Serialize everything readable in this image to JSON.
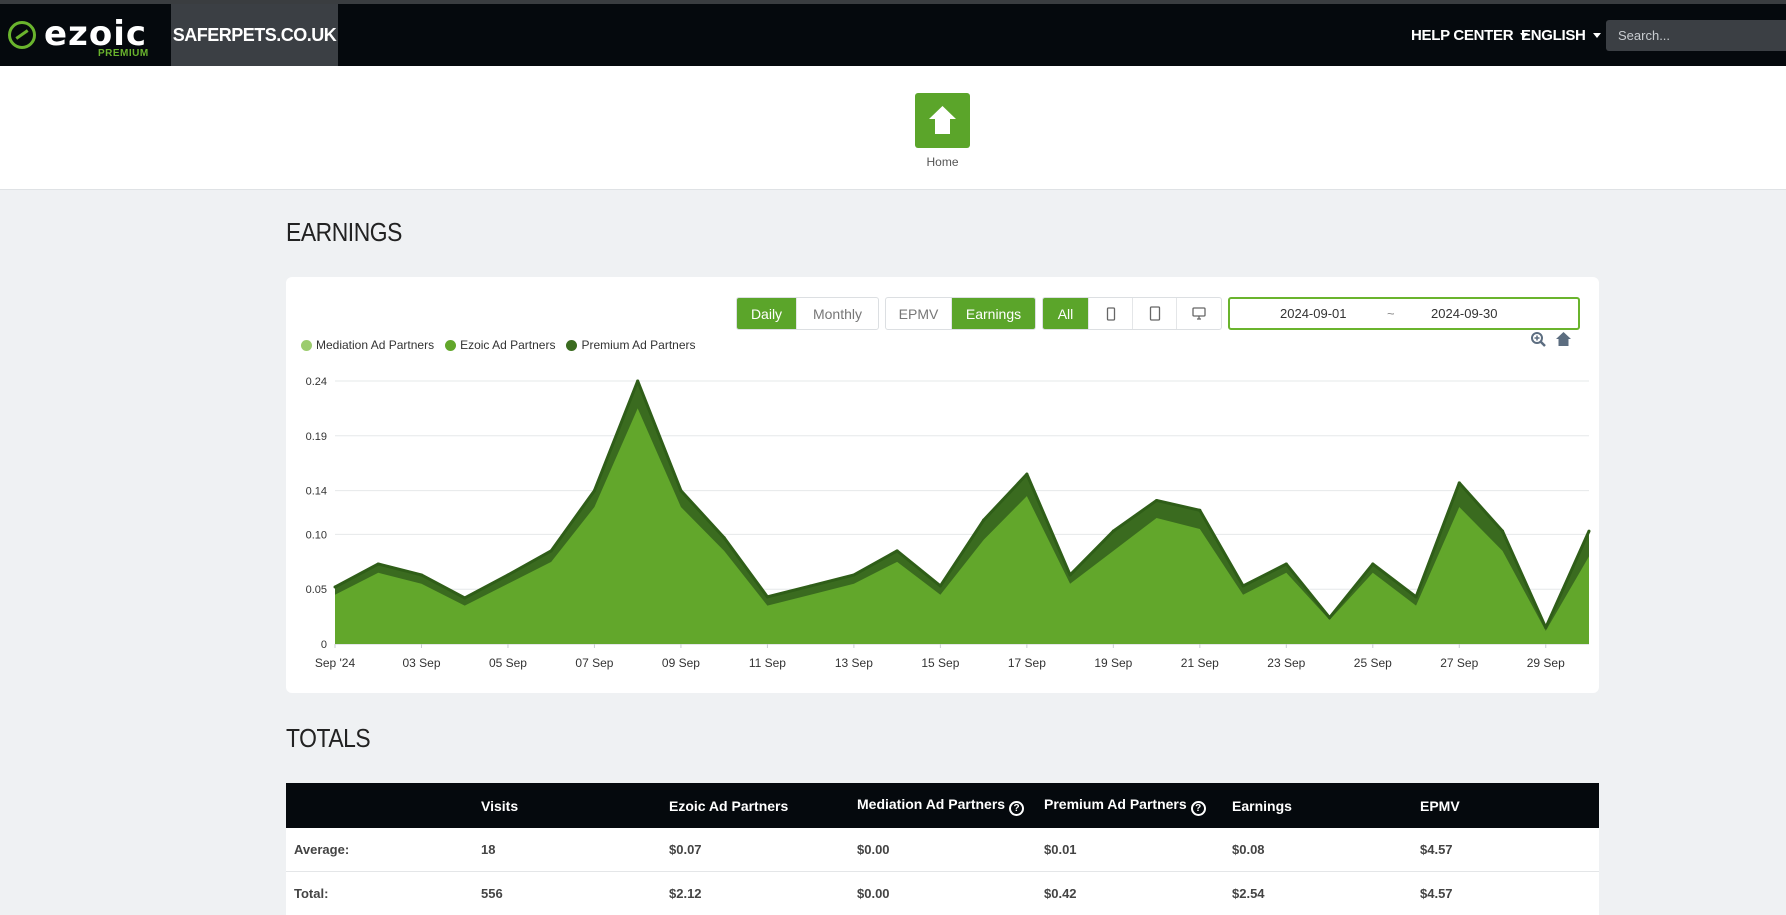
{
  "nav": {
    "logo_text": "ezoic",
    "logo_sub": "PREMIUM",
    "site": "SAFERPETS.CO.UK",
    "help_center": "HELP CENTER",
    "language": "ENGLISH",
    "search_placeholder": "Search..."
  },
  "home": {
    "label": "Home"
  },
  "earnings": {
    "title": "EARNINGS",
    "period_buttons": [
      {
        "label": "Daily",
        "active": true
      },
      {
        "label": "Monthly",
        "active": false
      }
    ],
    "metric_buttons": [
      {
        "label": "EPMV",
        "active": false
      },
      {
        "label": "Earnings",
        "active": true
      }
    ],
    "device_buttons": [
      {
        "label": "All",
        "icon": "",
        "active": true
      },
      {
        "label": "",
        "icon": "mobile-icon",
        "active": false
      },
      {
        "label": "",
        "icon": "tablet-icon",
        "active": false
      },
      {
        "label": "",
        "icon": "desktop-icon",
        "active": false
      }
    ],
    "date_start": "2024-09-01",
    "date_sep": "~",
    "date_end": "2024-09-30",
    "tools": [
      "zoom-icon",
      "reset-home-icon"
    ]
  },
  "chart_data": {
    "type": "area",
    "stacked": true,
    "x_tick_labels": [
      "Sep '24",
      "03 Sep",
      "05 Sep",
      "07 Sep",
      "09 Sep",
      "11 Sep",
      "13 Sep",
      "15 Sep",
      "17 Sep",
      "19 Sep",
      "21 Sep",
      "23 Sep",
      "25 Sep",
      "27 Sep",
      "29 Sep"
    ],
    "y_tick_labels": [
      "0",
      "0.05",
      "0.10",
      "0.14",
      "0.19",
      "0.24"
    ],
    "ylim": [
      0,
      0.24
    ],
    "grid": true,
    "legend_position": "top-left",
    "days": [
      1,
      2,
      3,
      4,
      5,
      6,
      7,
      8,
      9,
      10,
      11,
      12,
      13,
      14,
      15,
      16,
      17,
      18,
      19,
      20,
      21,
      22,
      23,
      24,
      25,
      26,
      27,
      28,
      29,
      30
    ],
    "series": [
      {
        "name": "Mediation Ad Partners",
        "color": "#9ccc6e",
        "values": [
          0,
          0,
          0,
          0,
          0,
          0,
          0,
          0,
          0,
          0,
          0,
          0,
          0,
          0,
          0,
          0,
          0,
          0,
          0,
          0,
          0,
          0,
          0,
          0,
          0,
          0,
          0,
          0,
          0,
          0
        ]
      },
      {
        "name": "Ezoic Ad Partners",
        "color": "#62a72b",
        "values": [
          0.045,
          0.065,
          0.055,
          0.035,
          0.055,
          0.075,
          0.125,
          0.215,
          0.125,
          0.085,
          0.035,
          0.045,
          0.055,
          0.075,
          0.045,
          0.095,
          0.135,
          0.055,
          0.085,
          0.115,
          0.105,
          0.045,
          0.065,
          0.022,
          0.065,
          0.035,
          0.125,
          0.085,
          0.012,
          0.08
        ]
      },
      {
        "name": "Premium Ad Partners",
        "color": "#3a6b1f",
        "values": [
          0.007,
          0.008,
          0.008,
          0.007,
          0.008,
          0.01,
          0.015,
          0.025,
          0.015,
          0.012,
          0.008,
          0.008,
          0.008,
          0.01,
          0.008,
          0.018,
          0.02,
          0.008,
          0.018,
          0.016,
          0.017,
          0.008,
          0.008,
          0.002,
          0.008,
          0.008,
          0.022,
          0.018,
          0.003,
          0.023
        ]
      }
    ]
  },
  "totals": {
    "title": "TOTALS",
    "columns": [
      "",
      "Visits",
      "Ezoic Ad Partners",
      "Mediation Ad Partners",
      "Premium Ad Partners",
      "Earnings",
      "EPMV"
    ],
    "rows": [
      [
        "Average:",
        "18",
        "$0.07",
        "$0.00",
        "$0.01",
        "$0.08",
        "$4.57"
      ],
      [
        "Total:",
        "556",
        "$2.12",
        "$0.00",
        "$0.42",
        "$2.54",
        "$4.57"
      ]
    ]
  },
  "colors": {
    "accent": "#5ba52a",
    "nav_bg": "#05090d",
    "site_tab_bg": "#3b3f44"
  }
}
